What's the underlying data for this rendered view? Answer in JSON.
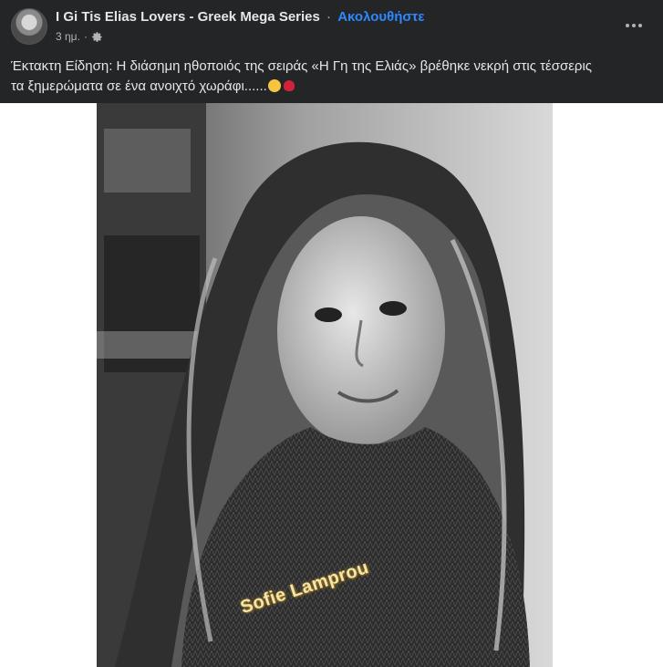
{
  "post": {
    "page_name": "I Gi Tis Elias Lovers - Greek Mega Series",
    "separator": "·",
    "follow_label": "Ακολουθήστε",
    "time": "3 ημ.",
    "meta_separator": "·",
    "audience_icon": "gear-icon",
    "more_icon": "more-options-icon",
    "text_line1": "Έκτακτη Είδηση: Η διάσημη ηθοποιός της σειράς «Η Γη της Ελιάς» βρέθηκε νεκρή στις τέσσερις",
    "text_line2": "τα ξημερώματα σε ένα ανοιχτό χωράφι......",
    "emojis": [
      "disappointed-face",
      "rose"
    ],
    "photo_watermark": "Sofie Lamprou"
  },
  "colors": {
    "background": "#242526",
    "text": "#e4e6eb",
    "secondary_text": "#b0b3b8",
    "link_blue": "#2d88ff"
  }
}
